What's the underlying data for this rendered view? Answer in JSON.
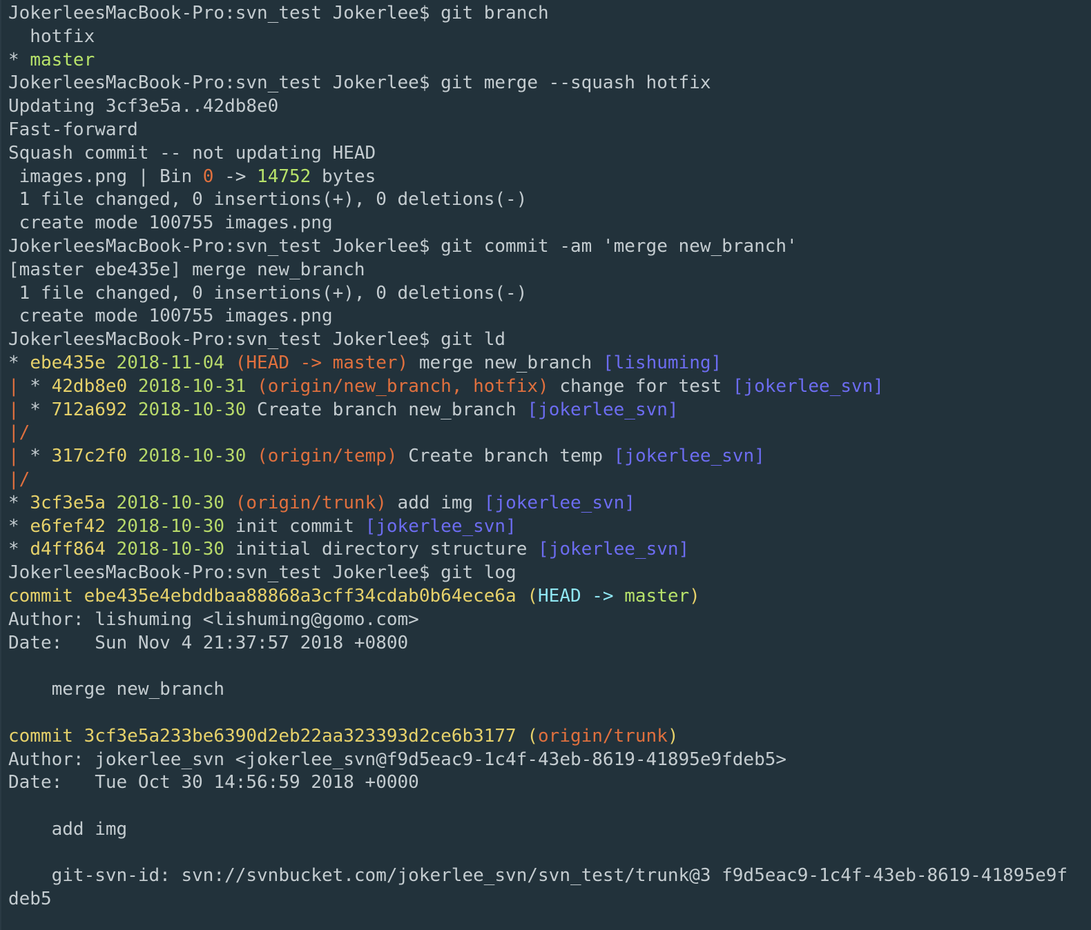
{
  "colors": {
    "background": "#22323b",
    "default_text": "#c4ccd0",
    "hash_yellow": "#e6d16a",
    "date_green": "#b7d96a",
    "ref_orange": "#e0703e",
    "author_blue": "#6c6cf0",
    "head_cyan": "#8fe6f2",
    "master_green": "#b7e26a",
    "graph_red": "#e0703e"
  },
  "terminal": {
    "lines": [
      [
        {
          "t": "JokerleesMacBook-Pro:svn_test Jokerlee$ git branch",
          "c": "#c4ccd0"
        }
      ],
      [
        {
          "t": "  hotfix",
          "c": "#c4ccd0"
        }
      ],
      [
        {
          "t": "* ",
          "c": "#c4ccd0"
        },
        {
          "t": "master",
          "c": "#b7e26a"
        }
      ],
      [
        {
          "t": "JokerleesMacBook-Pro:svn_test Jokerlee$ git merge --squash hotfix",
          "c": "#c4ccd0"
        }
      ],
      [
        {
          "t": "Updating 3cf3e5a..42db8e0",
          "c": "#c4ccd0"
        }
      ],
      [
        {
          "t": "Fast-forward",
          "c": "#c4ccd0"
        }
      ],
      [
        {
          "t": "Squash commit -- not updating HEAD",
          "c": "#c4ccd0"
        }
      ],
      [
        {
          "t": " images.png | Bin ",
          "c": "#c4ccd0"
        },
        {
          "t": "0",
          "c": "#e0703e"
        },
        {
          "t": " -> ",
          "c": "#c4ccd0"
        },
        {
          "t": "14752",
          "c": "#b7e26a"
        },
        {
          "t": " bytes",
          "c": "#c4ccd0"
        }
      ],
      [
        {
          "t": " 1 file changed, 0 insertions(+), 0 deletions(-)",
          "c": "#c4ccd0"
        }
      ],
      [
        {
          "t": " create mode 100755 images.png",
          "c": "#c4ccd0"
        }
      ],
      [
        {
          "t": "JokerleesMacBook-Pro:svn_test Jokerlee$ git commit -am 'merge new_branch'",
          "c": "#c4ccd0"
        }
      ],
      [
        {
          "t": "[master ebe435e] merge new_branch",
          "c": "#c4ccd0"
        }
      ],
      [
        {
          "t": " 1 file changed, 0 insertions(+), 0 deletions(-)",
          "c": "#c4ccd0"
        }
      ],
      [
        {
          "t": " create mode 100755 images.png",
          "c": "#c4ccd0"
        }
      ],
      [
        {
          "t": "JokerleesMacBook-Pro:svn_test Jokerlee$ git ld",
          "c": "#c4ccd0"
        }
      ],
      [
        {
          "t": "* ",
          "c": "#c4ccd0"
        },
        {
          "t": "ebe435e",
          "c": "#e6d16a"
        },
        {
          "t": " ",
          "c": "#c4ccd0"
        },
        {
          "t": "2018-11-04",
          "c": "#b7d96a"
        },
        {
          "t": " ",
          "c": "#c4ccd0"
        },
        {
          "t": "(HEAD -> master)",
          "c": "#e0703e"
        },
        {
          "t": " merge new_branch ",
          "c": "#c4ccd0"
        },
        {
          "t": "[lishuming]",
          "c": "#6c6cf0"
        }
      ],
      [
        {
          "t": "|",
          "c": "#e0703e"
        },
        {
          "t": " * ",
          "c": "#c4ccd0"
        },
        {
          "t": "42db8e0",
          "c": "#e6d16a"
        },
        {
          "t": " ",
          "c": "#c4ccd0"
        },
        {
          "t": "2018-10-31",
          "c": "#b7d96a"
        },
        {
          "t": " ",
          "c": "#c4ccd0"
        },
        {
          "t": "(origin/new_branch, hotfix)",
          "c": "#e0703e"
        },
        {
          "t": " change for test ",
          "c": "#c4ccd0"
        },
        {
          "t": "[jokerlee_svn]",
          "c": "#6c6cf0"
        }
      ],
      [
        {
          "t": "|",
          "c": "#e0703e"
        },
        {
          "t": " * ",
          "c": "#c4ccd0"
        },
        {
          "t": "712a692",
          "c": "#e6d16a"
        },
        {
          "t": " ",
          "c": "#c4ccd0"
        },
        {
          "t": "2018-10-30",
          "c": "#b7d96a"
        },
        {
          "t": " Create branch new_branch ",
          "c": "#c4ccd0"
        },
        {
          "t": "[jokerlee_svn]",
          "c": "#6c6cf0"
        }
      ],
      [
        {
          "t": "|/",
          "c": "#e0703e"
        }
      ],
      [
        {
          "t": "|",
          "c": "#e0703e"
        },
        {
          "t": " * ",
          "c": "#c4ccd0"
        },
        {
          "t": "317c2f0",
          "c": "#e6d16a"
        },
        {
          "t": " ",
          "c": "#c4ccd0"
        },
        {
          "t": "2018-10-30",
          "c": "#b7d96a"
        },
        {
          "t": " ",
          "c": "#c4ccd0"
        },
        {
          "t": "(origin/temp)",
          "c": "#e0703e"
        },
        {
          "t": " Create branch temp ",
          "c": "#c4ccd0"
        },
        {
          "t": "[jokerlee_svn]",
          "c": "#6c6cf0"
        }
      ],
      [
        {
          "t": "|/",
          "c": "#e0703e"
        }
      ],
      [
        {
          "t": "* ",
          "c": "#c4ccd0"
        },
        {
          "t": "3cf3e5a",
          "c": "#e6d16a"
        },
        {
          "t": " ",
          "c": "#c4ccd0"
        },
        {
          "t": "2018-10-30",
          "c": "#b7d96a"
        },
        {
          "t": " ",
          "c": "#c4ccd0"
        },
        {
          "t": "(origin/trunk)",
          "c": "#e0703e"
        },
        {
          "t": " add img ",
          "c": "#c4ccd0"
        },
        {
          "t": "[jokerlee_svn]",
          "c": "#6c6cf0"
        }
      ],
      [
        {
          "t": "* ",
          "c": "#c4ccd0"
        },
        {
          "t": "e6fef42",
          "c": "#e6d16a"
        },
        {
          "t": " ",
          "c": "#c4ccd0"
        },
        {
          "t": "2018-10-30",
          "c": "#b7d96a"
        },
        {
          "t": " init commit ",
          "c": "#c4ccd0"
        },
        {
          "t": "[jokerlee_svn]",
          "c": "#6c6cf0"
        }
      ],
      [
        {
          "t": "* ",
          "c": "#c4ccd0"
        },
        {
          "t": "d4ff864",
          "c": "#e6d16a"
        },
        {
          "t": " ",
          "c": "#c4ccd0"
        },
        {
          "t": "2018-10-30",
          "c": "#b7d96a"
        },
        {
          "t": " initial directory structure ",
          "c": "#c4ccd0"
        },
        {
          "t": "[jokerlee_svn]",
          "c": "#6c6cf0"
        }
      ],
      [
        {
          "t": "JokerleesMacBook-Pro:svn_test Jokerlee$ git log",
          "c": "#c4ccd0"
        }
      ],
      [
        {
          "t": "commit ebe435e4ebddbaa88868a3cff34cdab0b64ece6a ",
          "c": "#e6d16a"
        },
        {
          "t": "(",
          "c": "#e6d16a"
        },
        {
          "t": "HEAD -> ",
          "c": "#8fe6f2"
        },
        {
          "t": "master",
          "c": "#b7e26a"
        },
        {
          "t": ")",
          "c": "#e6d16a"
        }
      ],
      [
        {
          "t": "Author: lishuming <lishuming@gomo.com>",
          "c": "#c4ccd0"
        }
      ],
      [
        {
          "t": "Date:   Sun Nov 4 21:37:57 2018 +0800",
          "c": "#c4ccd0"
        }
      ],
      [
        {
          "t": "",
          "c": "#c4ccd0"
        }
      ],
      [
        {
          "t": "    merge new_branch",
          "c": "#c4ccd0"
        }
      ],
      [
        {
          "t": "",
          "c": "#c4ccd0"
        }
      ],
      [
        {
          "t": "commit 3cf3e5a233be6390d2eb22aa323393d2ce6b3177 ",
          "c": "#e6d16a"
        },
        {
          "t": "(",
          "c": "#e6d16a"
        },
        {
          "t": "origin/trunk",
          "c": "#e0703e"
        },
        {
          "t": ")",
          "c": "#e6d16a"
        }
      ],
      [
        {
          "t": "Author: jokerlee_svn <jokerlee_svn@f9d5eac9-1c4f-43eb-8619-41895e9fdeb5>",
          "c": "#c4ccd0"
        }
      ],
      [
        {
          "t": "Date:   Tue Oct 30 14:56:59 2018 +0000",
          "c": "#c4ccd0"
        }
      ],
      [
        {
          "t": "",
          "c": "#c4ccd0"
        }
      ],
      [
        {
          "t": "    add img",
          "c": "#c4ccd0"
        }
      ],
      [
        {
          "t": "",
          "c": "#c4ccd0"
        }
      ],
      [
        {
          "t": "    git-svn-id: svn://svnbucket.com/jokerlee_svn/svn_test/trunk@3 f9d5eac9-1c4f-43eb-8619-41895e9f",
          "c": "#c4ccd0"
        }
      ],
      [
        {
          "t": "deb5",
          "c": "#c4ccd0"
        }
      ]
    ]
  }
}
